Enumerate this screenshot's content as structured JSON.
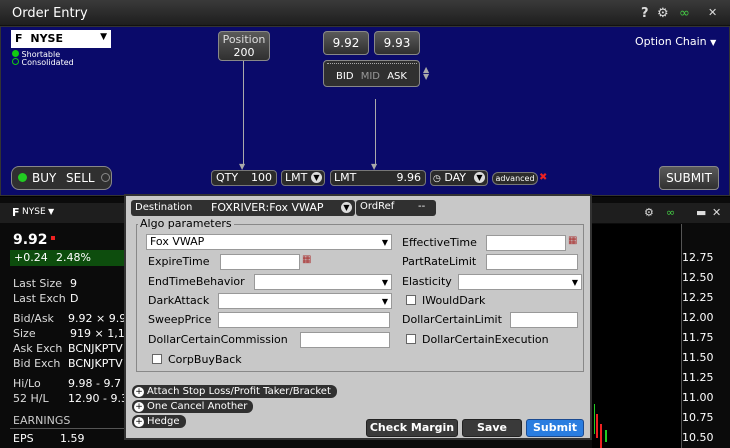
{
  "window": {
    "title": "Order Entry",
    "help": "?"
  },
  "symbol": {
    "ticker": "F",
    "exchange": "NYSE",
    "shortable": "Shortable",
    "consolidated": "Consolidated"
  },
  "position": {
    "label": "Position",
    "value": "200"
  },
  "quote": {
    "bid": "9.92",
    "ask": "9.93",
    "bid_label": "BID",
    "mid_label": "MID",
    "ask_label": "ASK"
  },
  "option_chain": "Option Chain",
  "order": {
    "buy": "BUY",
    "sell": "SELL",
    "qty_label": "QTY",
    "qty": "100",
    "type": "LMT",
    "price_type": "LMT",
    "price": "9.96",
    "tif": "DAY",
    "advanced": "advanced",
    "submit": "SUBMIT"
  },
  "lower": {
    "ticker": "F",
    "exchange": "NYSE",
    "last": "9.92",
    "change": "+0.24",
    "change_pct": "2.48%",
    "rows": [
      {
        "label": "Last Size",
        "value": "9"
      },
      {
        "label": "Last Exch",
        "value": "D"
      },
      {
        "label": "Bid/Ask",
        "value": "9.92 × 9.9"
      },
      {
        "label": "Size",
        "value": "919 × 1,1"
      },
      {
        "label": "Ask Exch",
        "value": "BCNJKPTV"
      },
      {
        "label": "Bid Exch",
        "value": "BCNJKPTV"
      },
      {
        "label": "Hi/Lo",
        "value": "9.98 - 9.7"
      },
      {
        "label": "52 H/L",
        "value": "12.90 - 9.3"
      }
    ],
    "earnings": "EARNINGS",
    "eps_label": "EPS",
    "eps": "1.59",
    "price_axis": [
      "12.75",
      "12.50",
      "12.25",
      "12.00",
      "11.75",
      "11.50",
      "11.25",
      "11.00",
      "10.75",
      "10.50"
    ]
  },
  "dialog": {
    "destination_label": "Destination",
    "destination": "FOXRIVER:Fox VWAP",
    "ordref_label": "OrdRef",
    "ordref": "--",
    "algo_title": "Algo parameters",
    "algo_select": "Fox VWAP",
    "expire_time": "ExpireTime",
    "end_time_behavior": "EndTimeBehavior",
    "dark_attack": "DarkAttack",
    "sweep_price": "SweepPrice",
    "dollar_certain_commission": "DollarCertainCommission",
    "corp_buy_back": "CorpBuyBack",
    "effective_time": "EffectiveTime",
    "part_rate_limit": "PartRateLimit",
    "elasticity": "Elasticity",
    "i_would_dark": "IWouldDark",
    "dollar_certain_limit": "DollarCertainLimit",
    "dollar_certain_execution": "DollarCertainExecution",
    "attach": "Attach Stop Loss/Profit Taker/Bracket",
    "oca": "One Cancel Another",
    "hedge": "Hedge",
    "check_margin": "Check Margin",
    "save": "Save",
    "submit": "Submit"
  },
  "colors": {
    "panel": "#0a0a6a",
    "green": "#1a9a1a",
    "submit_blue": "#2a7de0"
  }
}
